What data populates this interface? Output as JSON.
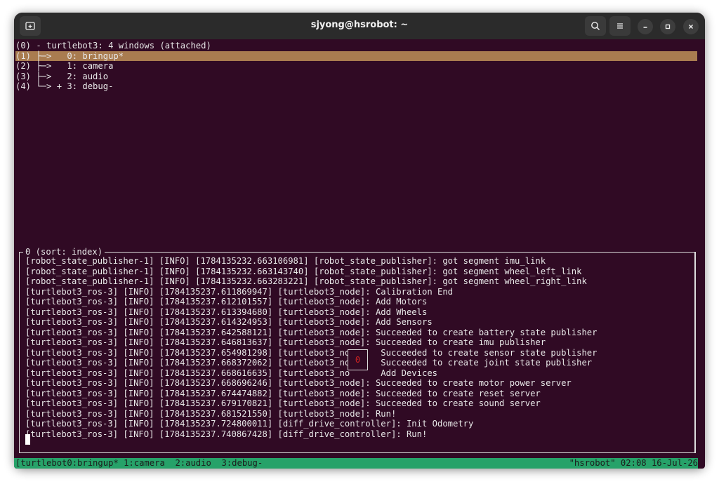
{
  "window": {
    "title": "sjyong@hsrobot: ~"
  },
  "tree": {
    "session": "(0) - turtlebot3: 4 windows (attached)",
    "items": [
      "(1) ├─>   0: bringup*",
      "(2) ├─>   1: camera",
      "(3) ├─>   2: audio",
      "(4) └─> + 3: debug-"
    ]
  },
  "pane": {
    "title": "0 (sort: index)",
    "overlay_number": "0",
    "log": [
      "[robot_state_publisher-1] [INFO] [1784135232.663106981] [robot_state_publisher]: got segment imu_link",
      "[robot_state_publisher-1] [INFO] [1784135232.663143740] [robot_state_publisher]: got segment wheel_left_link",
      "[robot_state_publisher-1] [INFO] [1784135232.663283221] [robot_state_publisher]: got segment wheel_right_link",
      "[turtlebot3_ros-3] [INFO] [1784135237.611869947] [turtlebot3_node]: Calibration End",
      "[turtlebot3_ros-3] [INFO] [1784135237.612101557] [turtlebot3_node]: Add Motors",
      "[turtlebot3_ros-3] [INFO] [1784135237.613394680] [turtlebot3_node]: Add Wheels",
      "[turtlebot3_ros-3] [INFO] [1784135237.614324953] [turtlebot3_node]: Add Sensors",
      "[turtlebot3_ros-3] [INFO] [1784135237.642588121] [turtlebot3_node]: Succeeded to create battery state publisher",
      "[turtlebot3_ros-3] [INFO] [1784135237.646813637] [turtlebot3_node]: Succeeded to create imu publisher",
      "[turtlebot3_ros-3] [INFO] [1784135237.654981298] [turtlebot3_no      Succeeded to create sensor state publisher",
      "[turtlebot3_ros-3] [INFO] [1784135237.668372062] [turtlebot3_no      Succeeded to create joint state publisher",
      "[turtlebot3_ros-3] [INFO] [1784135237.668616635] [turtlebot3_no      Add Devices",
      "[turtlebot3_ros-3] [INFO] [1784135237.668696246] [turtlebot3_node]: Succeeded to create motor power server",
      "[turtlebot3_ros-3] [INFO] [1784135237.674474882] [turtlebot3_node]: Succeeded to create reset server",
      "[turtlebot3_ros-3] [INFO] [1784135237.679170821] [turtlebot3_node]: Succeeded to create sound server",
      "[turtlebot3_ros-3] [INFO] [1784135237.681521550] [turtlebot3_node]: Run!",
      "[turtlebot3_ros-3] [INFO] [1784135237.724800011] [diff_drive_controller]: Init Odometry",
      "[turtlebot3_ros-3] [INFO] [1784135237.740867428] [diff_drive_controller]: Run!"
    ]
  },
  "status": {
    "left": "[turtlebot0:bringup* 1:camera  2:audio  3:debug-",
    "right": "\"hsrobot\" 02:08 16-Jul-26"
  },
  "icons": {
    "new_tab": "new-tab-icon",
    "search": "search-icon",
    "menu": "hamburger-menu-icon",
    "minimize": "minimize-icon",
    "maximize": "maximize-icon",
    "close": "close-icon"
  },
  "colors": {
    "terminal_bg": "#300a24",
    "selection": "#a97c50",
    "status_bar": "#26a269",
    "titlebar": "#2b2b2b"
  }
}
